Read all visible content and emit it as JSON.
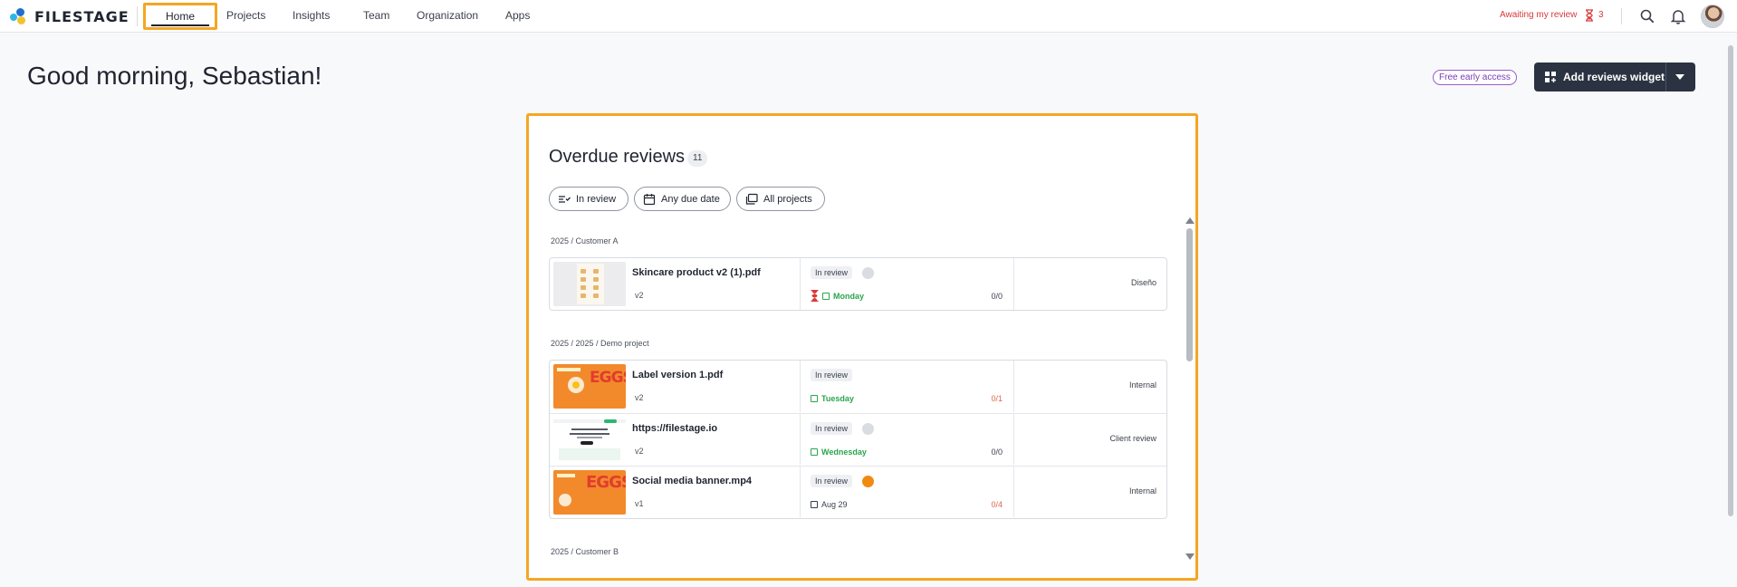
{
  "app": {
    "logo_text": "FILESTAGE"
  },
  "nav": {
    "items": [
      {
        "label": "Home",
        "active": true
      },
      {
        "label": "Projects"
      },
      {
        "label": "Insights"
      },
      {
        "label": "Team"
      },
      {
        "label": "Organization"
      },
      {
        "label": "Apps"
      }
    ]
  },
  "topbar": {
    "awaiting_label": "Awaiting my review",
    "awaiting_count": "3",
    "icons": [
      "hourglass-icon",
      "search-icon",
      "bell-icon",
      "user-avatar"
    ]
  },
  "header": {
    "greeting": "Good morning, Sebastian!",
    "early_access_badge": "Free early access",
    "add_widget_label": "Add reviews widget"
  },
  "widget": {
    "title": "Overdue reviews",
    "count": "11",
    "filters": [
      {
        "label": "In review",
        "icon": "checklist-icon"
      },
      {
        "label": "Any due date",
        "icon": "calendar-icon"
      },
      {
        "label": "All projects",
        "icon": "folders-icon"
      }
    ],
    "groups": [
      {
        "path": "2025 / Customer A",
        "files": [
          {
            "name": "Skincare product v2 (1).pdf",
            "version": "v2",
            "status": "In review",
            "due": "Monday",
            "due_overdue_hourglass": true,
            "ratio": "0/0",
            "tag": "Diseño"
          }
        ]
      },
      {
        "path": "2025 / 2025 / Demo project",
        "files": [
          {
            "name": "Label version 1.pdf",
            "version": "v2",
            "status": "In review",
            "due": "Tuesday",
            "ratio": "0/1",
            "tag": "Internal"
          },
          {
            "name": "https://filestage.io",
            "version": "v2",
            "status": "In review",
            "due": "Wednesday",
            "ratio": "0/0",
            "tag": "Client review"
          },
          {
            "name": "Social media banner.mp4",
            "version": "v1",
            "status": "In review",
            "due": "Aug 29",
            "ratio": "0/4",
            "tag": "Internal"
          }
        ]
      },
      {
        "path": "2025 / Customer B",
        "files": []
      }
    ]
  },
  "colors": {
    "highlight": "#f5a623",
    "due_green": "#2aa54c",
    "alert_red": "#d83a3a",
    "primary_dark": "#2b3342"
  }
}
